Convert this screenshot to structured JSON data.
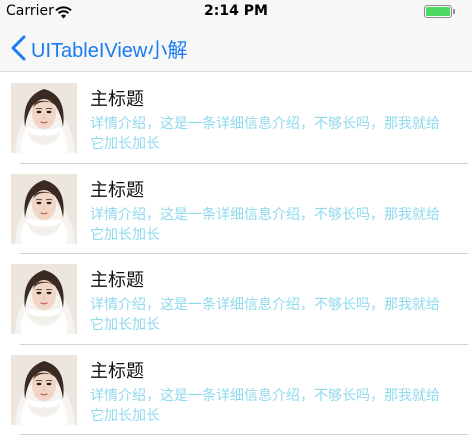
{
  "status_bar": {
    "carrier": "Carrier",
    "time": "2:14 PM",
    "battery_level": 1.0,
    "battery_color": "#4cd964"
  },
  "nav": {
    "back_label": "UITableIView小解",
    "tint_color": "#1a7cf0"
  },
  "cells": [
    {
      "title": "主标题",
      "detail": "详情介绍，这是一条详细信息介绍，不够长吗，那我就给它加长加长"
    },
    {
      "title": "主标题",
      "detail": "详情介绍，这是一条详细信息介绍，不够长吗，那我就给它加长加长"
    },
    {
      "title": "主标题",
      "detail": "详情介绍，这是一条详细信息介绍，不够长吗，那我就给它加长加长"
    },
    {
      "title": "主标题",
      "detail": "详情介绍，这是一条详细信息介绍，不够长吗，那我就给它加长加长"
    }
  ],
  "detail_color": "#8fd9ee"
}
